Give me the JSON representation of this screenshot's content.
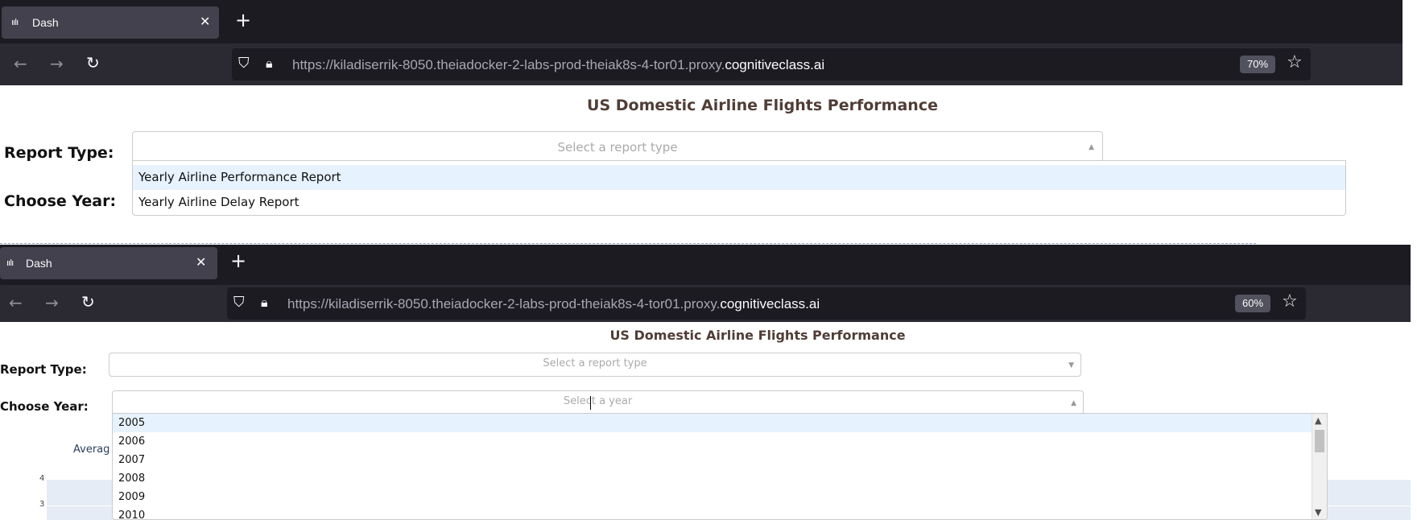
{
  "top_window": {
    "tab": {
      "title": "Dash",
      "icon": "dash-bar-chart-icon"
    },
    "new_tab_label": "+",
    "url": {
      "prefix": "https://kiladiserrik-8050.theiadocker-2-labs-prod-theiak8s-4-tor01.proxy.",
      "domain": "cognitiveclass.ai"
    },
    "zoom": "70%",
    "page": {
      "title": "US Domestic Airline Flights Performance",
      "report_type_label": "Report Type:",
      "choose_year_label": "Choose Year:",
      "report_dropdown_placeholder": "Select a report type",
      "report_options": [
        "Yearly Airline Performance Report",
        "Yearly Airline Delay Report"
      ]
    }
  },
  "bottom_window": {
    "tab": {
      "title": "Dash",
      "icon": "dash-bar-chart-icon"
    },
    "new_tab_label": "+",
    "url": {
      "prefix": "https://kiladiserrik-8050.theiadocker-2-labs-prod-theiak8s-4-tor01.proxy.",
      "domain": "cognitiveclass.ai"
    },
    "zoom": "60%",
    "page": {
      "title": "US Domestic Airline Flights Performance",
      "report_type_label": "Report Type:",
      "choose_year_label": "Choose Year:",
      "report_dropdown_placeholder": "Select a report type",
      "year_dropdown_placeholder": "Select a year",
      "year_options": [
        "2005",
        "2006",
        "2007",
        "2008",
        "2009",
        "2010"
      ],
      "partial_chart_title": "Averag",
      "partial_axis_ticks": [
        "4",
        "3"
      ]
    }
  },
  "colors": {
    "toolbar_dark": "#1c1b22",
    "toolbar": "#2b2a33",
    "title_brown": "#503d36",
    "option_highlight": "#e6f2fd"
  }
}
